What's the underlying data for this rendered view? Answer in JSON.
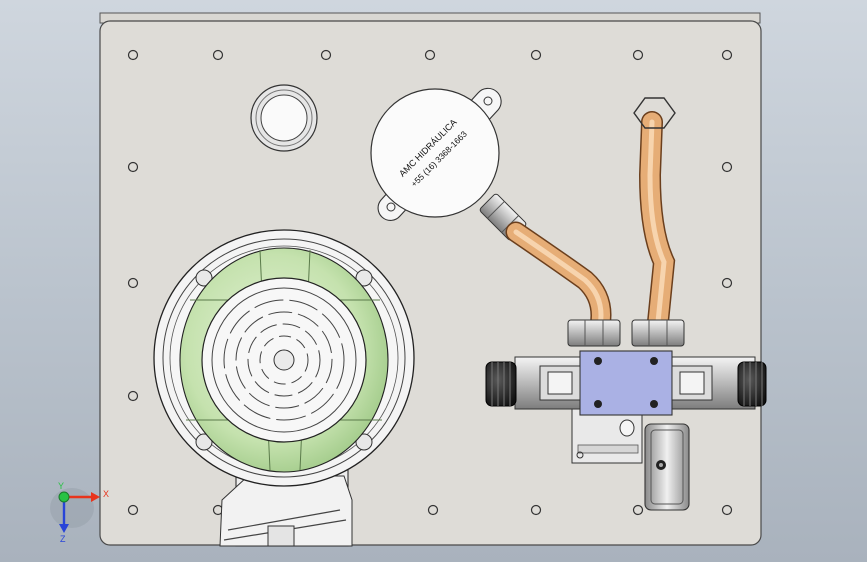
{
  "model": {
    "plate_label_line1": "AMC HIDRÁULICA",
    "plate_label_line2": "+55 (16) 3368-1663"
  },
  "triad": {
    "x_label": "X",
    "y_label": "Y",
    "z_label": "Z"
  },
  "colors": {
    "background_top": "#cfd6de",
    "background_bottom": "#a9b2bd",
    "plate": "#dedcd7",
    "motor_green": "#c9e4b4",
    "copper": "#e1a770",
    "valve_blue": "#aab1e4",
    "axis_x": "#e8341c",
    "axis_y": "#28c244",
    "axis_z": "#2844d8"
  }
}
